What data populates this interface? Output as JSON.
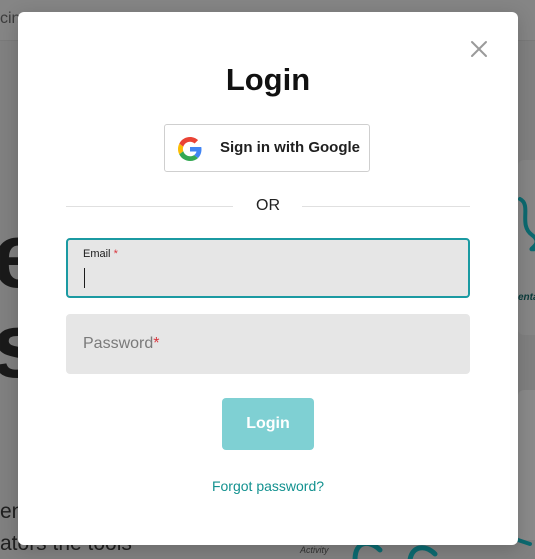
{
  "background": {
    "topbar_text": "cin",
    "hero_letters": [
      "e",
      "s"
    ],
    "body_lines": [
      "en",
      "ators the tools"
    ],
    "card_label": "enta",
    "activity_label": "Activity"
  },
  "modal": {
    "title": "Login",
    "close_icon": "close-icon",
    "google_button": {
      "label": "Sign in with Google",
      "icon": "google-g-icon"
    },
    "divider_text": "OR",
    "email": {
      "label": "Email",
      "required_marker": "*",
      "value": ""
    },
    "password": {
      "placeholder": "Password",
      "required_marker": "*"
    },
    "login_button": "Login",
    "forgot_link": "Forgot password?"
  },
  "colors": {
    "accent": "#1b9aa2",
    "login_button_bg": "#7fd0d3",
    "link": "#12918f",
    "required": "#d9363e",
    "field_bg": "#e6e6e6",
    "overlay": "#808080"
  }
}
